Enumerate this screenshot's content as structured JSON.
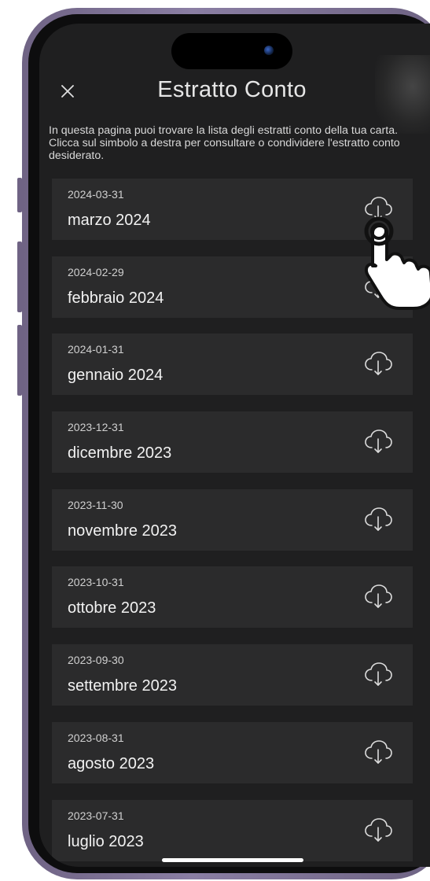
{
  "header": {
    "title": "Estratto Conto",
    "close_icon": "close-icon"
  },
  "intro_text": "In questa pagina puoi trovare la lista degli estratti conto della tua carta. Clicca sul simbolo a destra per consultare o condividere l'estratto conto desiderato.",
  "statements": [
    {
      "date": "2024-03-31",
      "label": "marzo 2024"
    },
    {
      "date": "2024-02-29",
      "label": "febbraio 2024"
    },
    {
      "date": "2024-01-31",
      "label": "gennaio 2024"
    },
    {
      "date": "2023-12-31",
      "label": "dicembre 2023"
    },
    {
      "date": "2023-11-30",
      "label": "novembre 2023"
    },
    {
      "date": "2023-10-31",
      "label": "ottobre 2023"
    },
    {
      "date": "2023-09-30",
      "label": "settembre 2023"
    },
    {
      "date": "2023-08-31",
      "label": "agosto 2023"
    },
    {
      "date": "2023-07-31",
      "label": "luglio 2023"
    }
  ],
  "row_icon": "cloud-download-icon",
  "overlay_icon": "tap-hand-icon",
  "colors": {
    "background": "#1f1f20",
    "row_background": "#2b2b2c",
    "text_primary": "#f2f2f2",
    "text_secondary": "#d0d0d0",
    "frame": "#7a6e92"
  }
}
